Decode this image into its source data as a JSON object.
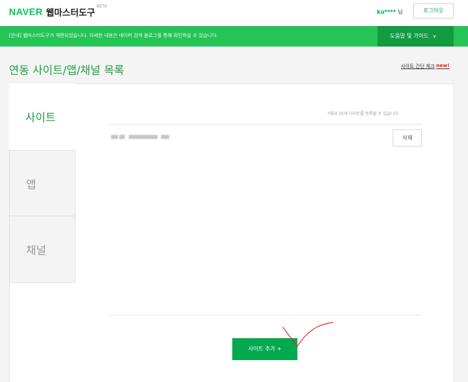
{
  "header": {
    "logo": "NAVER",
    "product": "웹마스터도구",
    "beta": "BETA",
    "user_id": "ku****",
    "user_suffix": " 님",
    "logout_label": "로그아웃"
  },
  "notice": {
    "text": "[안내] 웹마스터도구가 개편되었습니다. 자세한 내용은 네이버 검색 블로그를 통해 확인하실 수 있습니다.",
    "help_label": "도움말 및 가이드"
  },
  "page": {
    "title": "연동 사이트/앱/채널 목록",
    "quick_check": "사이트 간단 체크",
    "new_badge": "new!"
  },
  "tabs": [
    {
      "label": "사이트"
    },
    {
      "label": "앱"
    },
    {
      "label": "채널"
    }
  ],
  "content": {
    "limit_note": "*최대 10개 사이트를 등록할 수 있습니다.",
    "delete_label": "삭제",
    "add_site_label": "사이트 추가 +"
  },
  "colors": {
    "brand": "#03c75a",
    "notice_bar": "#26c357",
    "help_bar": "#129b41",
    "annotation": "#e03030"
  }
}
